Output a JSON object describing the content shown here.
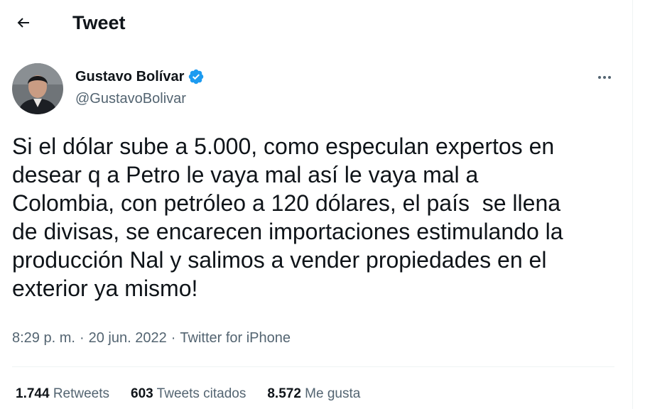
{
  "header": {
    "title": "Tweet"
  },
  "author": {
    "name": "Gustavo Bolívar",
    "handle": "@GustavoBolivar",
    "verified": true
  },
  "tweet": {
    "text": "Si el dólar sube a 5.000, como especulan expertos en\ndesear q a Petro le vaya mal así le vaya mal a\nColombia, con petróleo a 120 dólares, el país  se llena\nde divisas, se encarecen importaciones estimulando la\nproducción Nal y salimos a vender propiedades en el\nexterior ya mismo!",
    "time": "8:29 p. m.",
    "date": "20 jun. 2022",
    "source": "Twitter for iPhone",
    "separator": "·"
  },
  "stats": {
    "retweets_count": "1.744",
    "retweets_label": "Retweets",
    "quotes_count": "603",
    "quotes_label": "Tweets citados",
    "likes_count": "8.572",
    "likes_label": "Me gusta"
  },
  "colors": {
    "verified": "#1d9bf0",
    "secondary_text": "#536471",
    "primary_text": "#0f1419"
  },
  "icons": {
    "back": "arrow-left-icon",
    "verified": "verified-badge-icon",
    "more": "more-horizontal-icon"
  }
}
